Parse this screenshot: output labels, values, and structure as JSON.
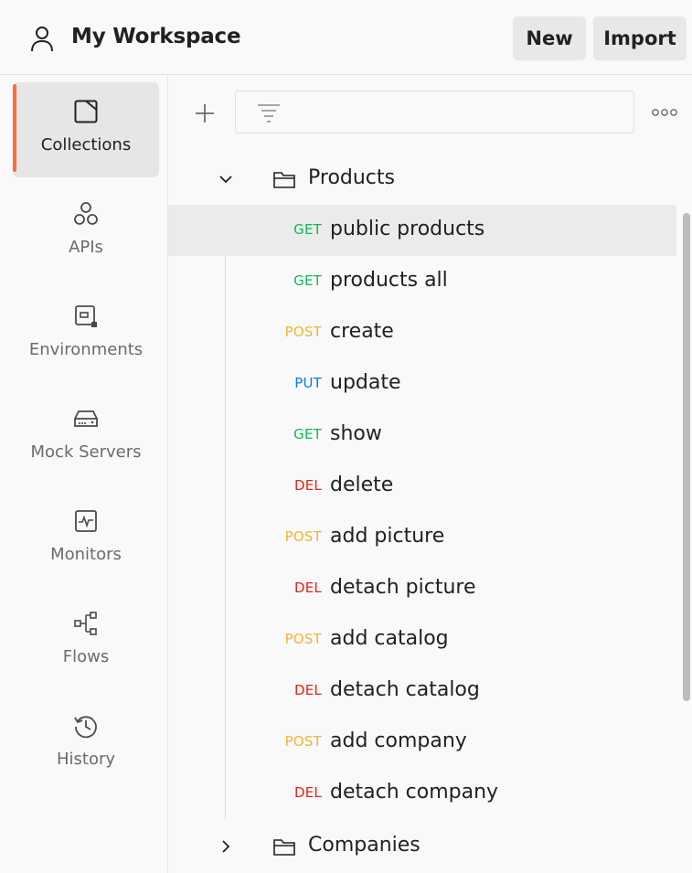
{
  "header": {
    "workspace_title": "My Workspace",
    "new_label": "New",
    "import_label": "Import"
  },
  "sidebar": {
    "items": [
      {
        "label": "Collections",
        "icon": "collections-icon",
        "active": true
      },
      {
        "label": "APIs",
        "icon": "apis-icon"
      },
      {
        "label": "Environments",
        "icon": "environments-icon"
      },
      {
        "label": "Mock Servers",
        "icon": "mock-servers-icon"
      },
      {
        "label": "Monitors",
        "icon": "monitors-icon"
      },
      {
        "label": "Flows",
        "icon": "flows-icon"
      },
      {
        "label": "History",
        "icon": "history-icon"
      }
    ]
  },
  "toolbar": {
    "filter_value": ""
  },
  "tree": {
    "folders": [
      {
        "name": "Products",
        "expanded": true,
        "requests": [
          {
            "method": "GET",
            "name": "public products",
            "selected": true
          },
          {
            "method": "GET",
            "name": "products all"
          },
          {
            "method": "POST",
            "name": "create"
          },
          {
            "method": "PUT",
            "name": "update"
          },
          {
            "method": "GET",
            "name": "show"
          },
          {
            "method": "DEL",
            "name": "delete"
          },
          {
            "method": "POST",
            "name": "add picture"
          },
          {
            "method": "DEL",
            "name": "detach picture"
          },
          {
            "method": "POST",
            "name": "add catalog"
          },
          {
            "method": "DEL",
            "name": "detach catalog"
          },
          {
            "method": "POST",
            "name": "add company"
          },
          {
            "method": "DEL",
            "name": "detach company"
          }
        ]
      },
      {
        "name": "Companies",
        "expanded": false,
        "requests": []
      }
    ]
  },
  "colors": {
    "accent": "#ff6c37",
    "get": "#0cbb52",
    "post": "#f0b62e",
    "put": "#097bed",
    "del": "#eb2013"
  }
}
